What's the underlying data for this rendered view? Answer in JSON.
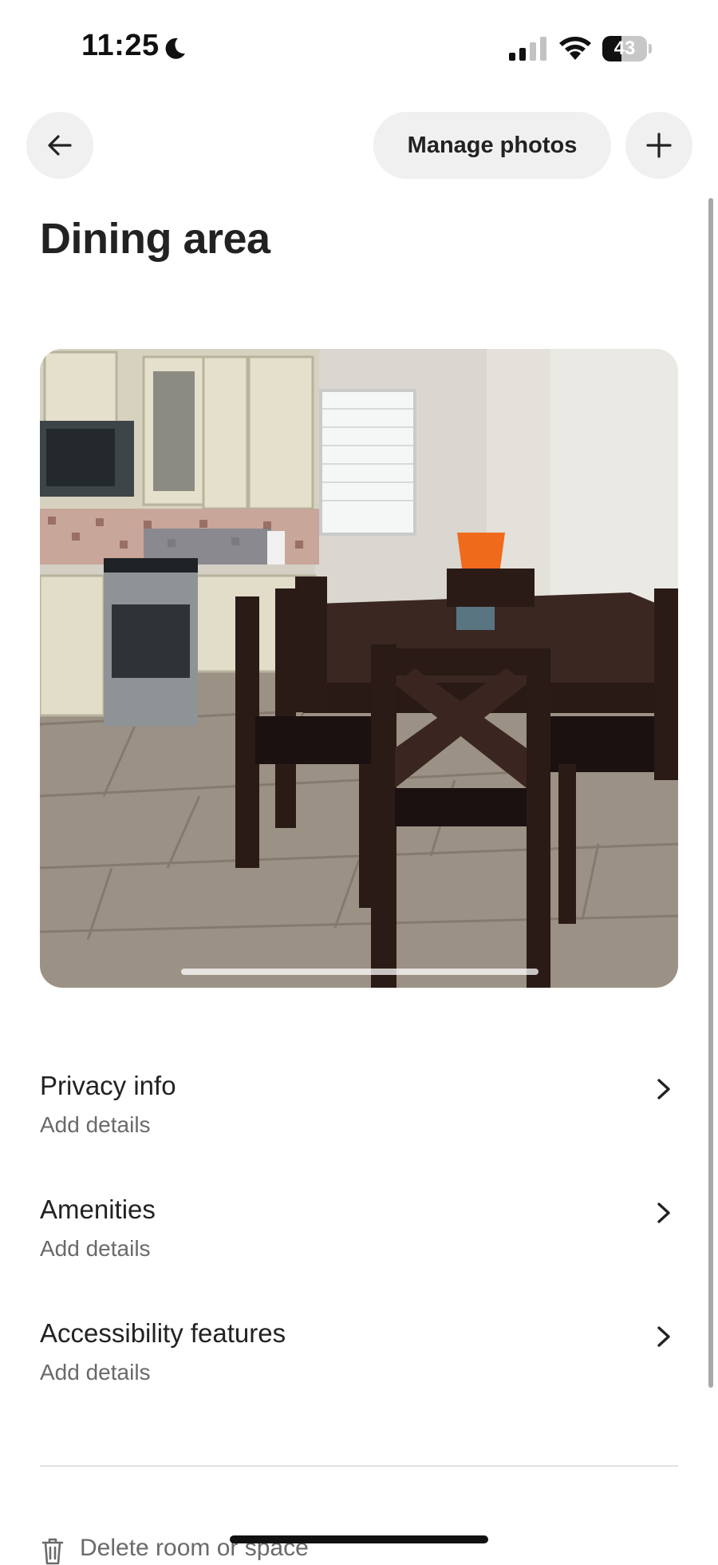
{
  "status_bar": {
    "time": "11:25",
    "battery_level": "43",
    "battery_fraction": 0.43,
    "icons": [
      "moon-icon",
      "signal-icon",
      "wifi-icon",
      "battery-icon"
    ]
  },
  "header": {
    "back_icon": "arrow-left-icon",
    "manage_photos_label": "Manage photos",
    "add_icon": "plus-icon"
  },
  "page": {
    "title": "Dining area"
  },
  "photo": {
    "alt": "Dining area photo"
  },
  "details": [
    {
      "title": "Privacy info",
      "subtitle": "Add details"
    },
    {
      "title": "Amenities",
      "subtitle": "Add details"
    },
    {
      "title": "Accessibility features",
      "subtitle": "Add details"
    }
  ],
  "footer": {
    "delete_label": "Delete room or space",
    "delete_icon": "trash-icon"
  }
}
